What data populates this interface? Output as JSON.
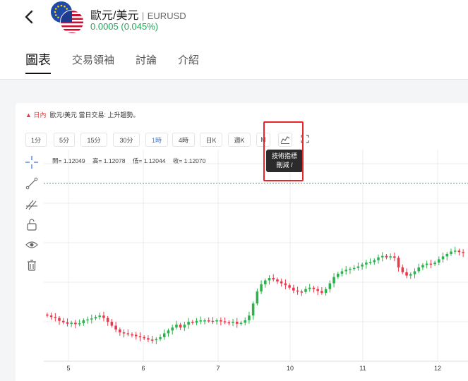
{
  "header": {
    "title": "歐元/美元",
    "separator": "|",
    "ticker": "EURUSD",
    "change": "0.0005 (0.045%)",
    "change_color": "#25a35a",
    "back_icon": "chevron-left-icon",
    "flags": [
      "eu-flag-icon",
      "us-flag-icon"
    ]
  },
  "tabs": [
    {
      "label": "圖表",
      "active": true
    },
    {
      "label": "交易領袖",
      "active": false
    },
    {
      "label": "討論",
      "active": false
    },
    {
      "label": "介紹",
      "active": false
    }
  ],
  "chart_panel": {
    "summary_marker": "▲",
    "summary_period": "日內",
    "summary_text": "歐元/美元 當日交易: 上升趨勢。",
    "timeframes": [
      "1分",
      "5分",
      "15分",
      "30分",
      "1時",
      "4時",
      "日K",
      "週K",
      "M"
    ],
    "active_timeframe": "1時",
    "tooltip_line1": "技術指標",
    "tooltip_line2": "刪減 /",
    "highlight_color": "#e8262a",
    "ohlc": {
      "open": "開= 1.12049",
      "high": "高= 1.12078",
      "low": "低= 1.12044",
      "close": "收= 1.12070"
    },
    "left_tools": [
      "crosshair-icon",
      "trendline-icon",
      "fib-icon",
      "lock-icon",
      "eye-icon",
      "trash-icon"
    ],
    "up_color": "#2bb24c",
    "down_color": "#e8394a"
  },
  "chart_data": {
    "type": "candlestick",
    "x_tick_labels": [
      "5",
      "6",
      "7",
      "10",
      "11",
      "12"
    ],
    "close_series": [
      0.55,
      0.52,
      0.5,
      0.44,
      0.41,
      0.38,
      0.4,
      0.37,
      0.39,
      0.45,
      0.47,
      0.49,
      0.52,
      0.55,
      0.5,
      0.42,
      0.34,
      0.26,
      0.2,
      0.18,
      0.16,
      0.15,
      0.12,
      0.1,
      0.08,
      0.05,
      0.04,
      0.06,
      0.1,
      0.18,
      0.24,
      0.3,
      0.36,
      0.3,
      0.36,
      0.42,
      0.4,
      0.44,
      0.45,
      0.45,
      0.44,
      0.43,
      0.45,
      0.43,
      0.41,
      0.4,
      0.42,
      0.38,
      0.4,
      0.45,
      0.55,
      0.8,
      1.05,
      1.2,
      1.28,
      1.33,
      1.3,
      1.26,
      1.22,
      1.18,
      1.13,
      1.07,
      1.05,
      1.04,
      1.1,
      1.13,
      1.1,
      1.06,
      1.02,
      1.1,
      1.22,
      1.35,
      1.42,
      1.47,
      1.5,
      1.52,
      1.54,
      1.57,
      1.61,
      1.65,
      1.66,
      1.7,
      1.76,
      1.79,
      1.76,
      1.78,
      1.75,
      1.55,
      1.45,
      1.38,
      1.41,
      1.47,
      1.55,
      1.6,
      1.63,
      1.62,
      1.65,
      1.72,
      1.78,
      1.83,
      1.88,
      1.9,
      1.87,
      1.85
    ],
    "dashed_level": 3.3,
    "y_range": [
      -0.4,
      4.0
    ]
  }
}
